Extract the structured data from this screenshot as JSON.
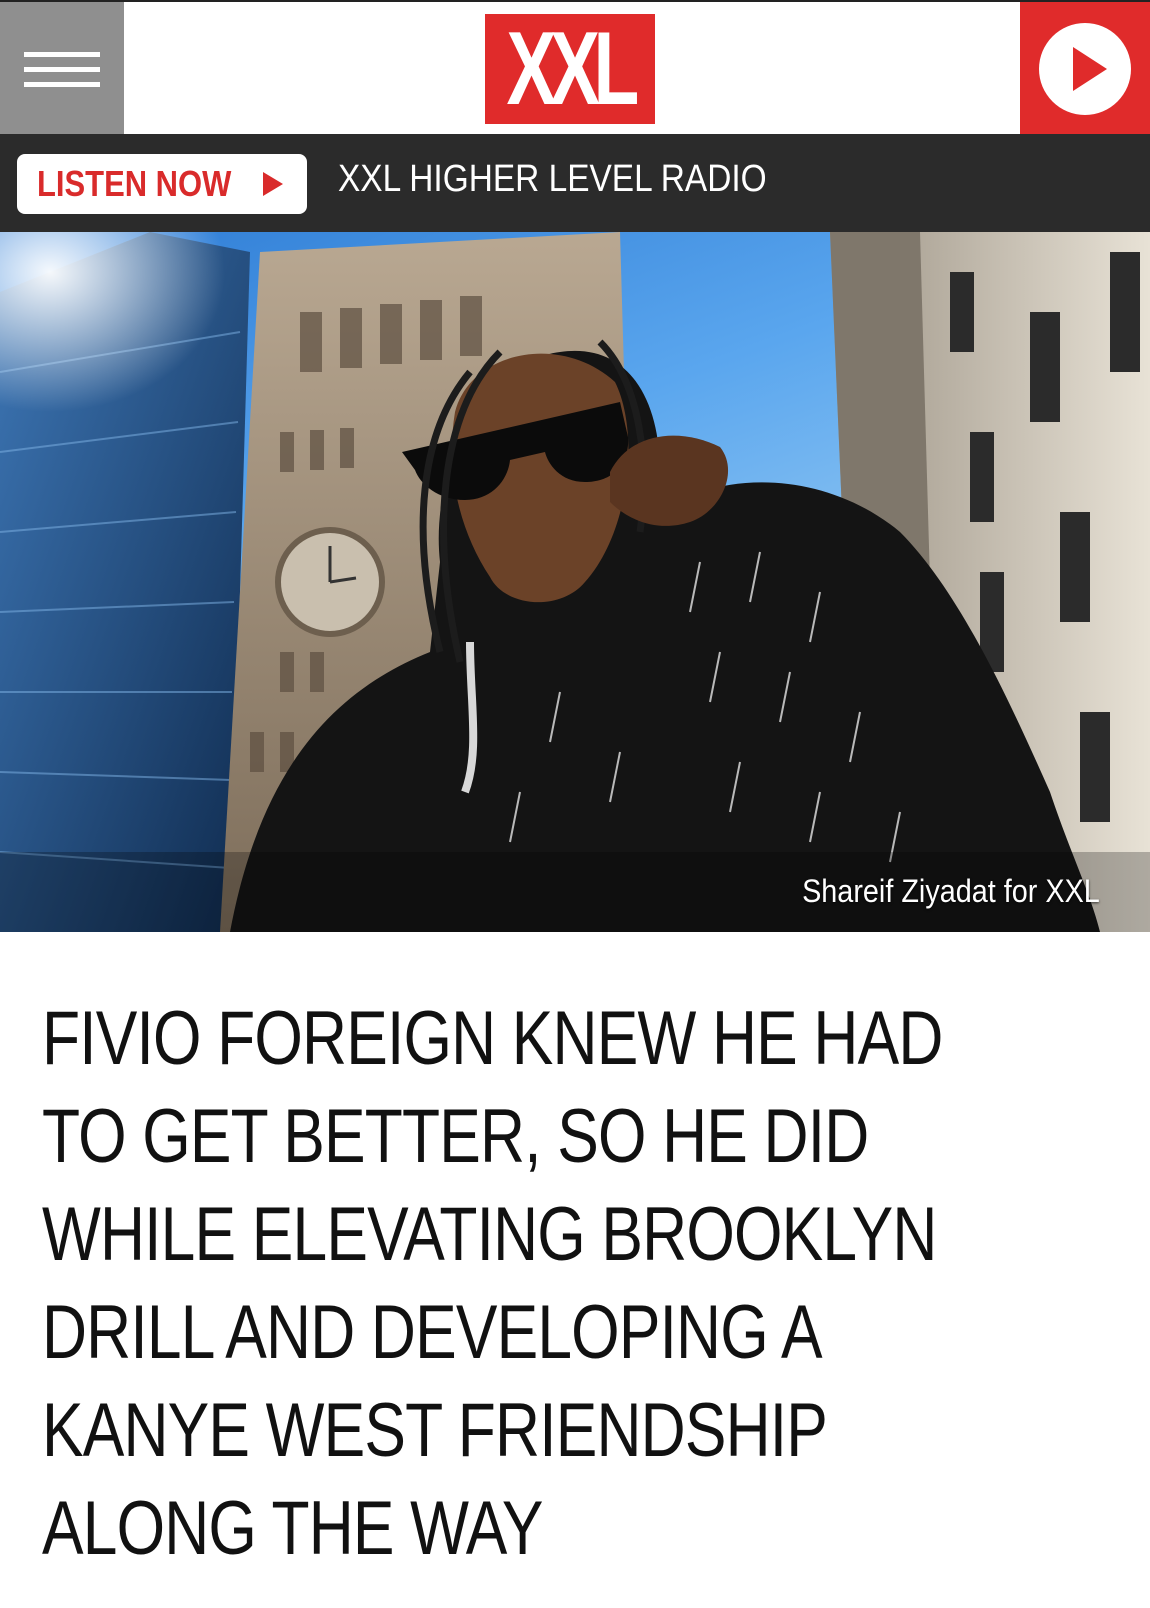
{
  "header": {
    "logo_text": "XXL",
    "menu_icon": "hamburger-icon",
    "play_icon": "play-icon",
    "brand_color": "#e02b2b"
  },
  "radio_bar": {
    "listen_label": "LISTEN NOW",
    "station_name": "XXL HIGHER LEVEL RADIO"
  },
  "hero": {
    "photo_credit": "Shareif Ziyadat for XXL"
  },
  "article": {
    "headline_lines": [
      "FIVIO FOREIGN KNEW HE HAD",
      "TO GET BETTER, SO HE DID",
      "WHILE ELEVATING BROOKLYN",
      "DRILL AND DEVELOPING A",
      "KANYE WEST FRIENDSHIP",
      "ALONG THE WAY"
    ]
  }
}
